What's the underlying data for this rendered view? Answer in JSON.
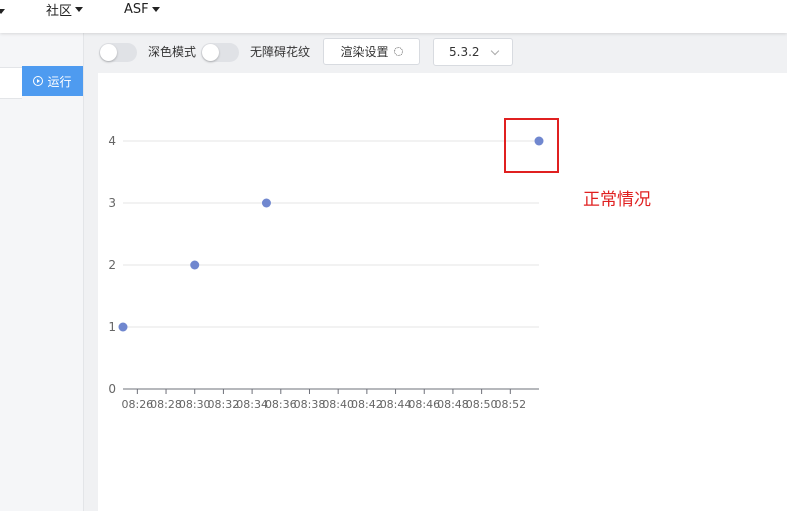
{
  "nav": {
    "items": [
      {
        "label": "社区"
      },
      {
        "label": "ASF"
      }
    ]
  },
  "editor": {
    "run_label": "运行"
  },
  "toolbar": {
    "dark_mode_label": "深色模式",
    "accessibility_label": "无障碍花纹",
    "render_settings_label": "渲染设置",
    "version_value": "5.3.2"
  },
  "annotation": {
    "text": "正常情况",
    "color": "#e02020"
  },
  "colors": {
    "accent": "#4e9bf0",
    "series": "#7087cf",
    "annotation_box": "#e02020"
  },
  "chart_data": {
    "type": "scatter",
    "title": "",
    "xlabel": "",
    "ylabel": "",
    "x_ticks": [
      "08:26",
      "08:28",
      "08:30",
      "08:32",
      "08:34",
      "08:36",
      "08:38",
      "08:40",
      "08:42",
      "08:44",
      "08:46",
      "08:48",
      "08:50",
      "08:52"
    ],
    "y_ticks": [
      0,
      1,
      2,
      3,
      4
    ],
    "xlim": [
      "08:25",
      "08:54"
    ],
    "ylim": [
      0,
      4
    ],
    "grid": true,
    "series": [
      {
        "points": [
          {
            "x": "08:25",
            "y": 1
          },
          {
            "x": "08:30",
            "y": 2
          },
          {
            "x": "08:35",
            "y": 3
          },
          {
            "x": "08:54",
            "y": 4
          }
        ]
      }
    ],
    "highlight_point_index": 3
  }
}
